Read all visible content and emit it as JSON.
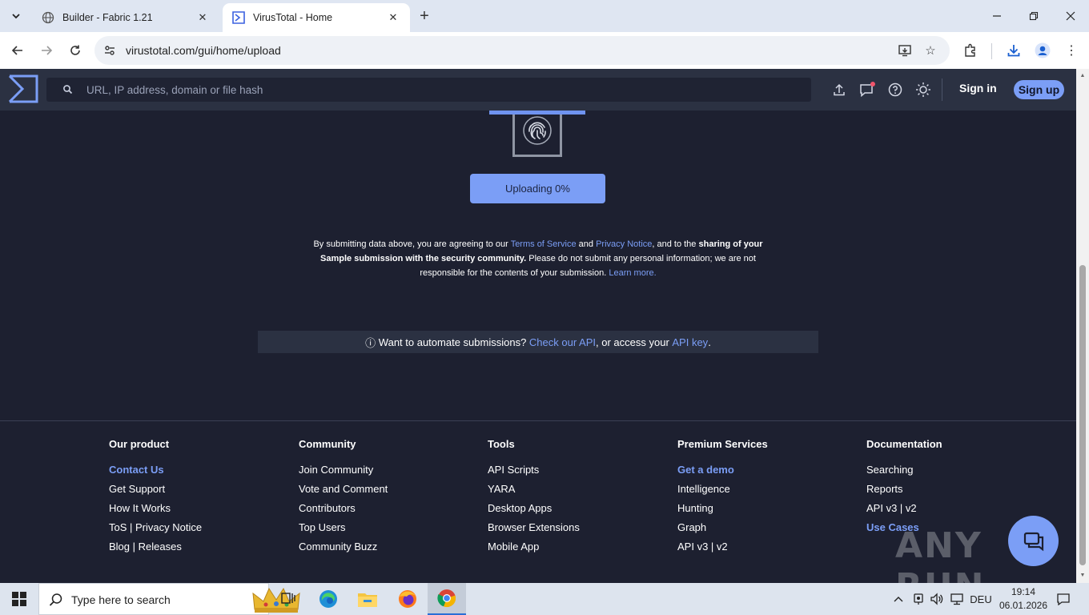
{
  "browser": {
    "tabs": [
      {
        "title": "Builder - Fabric 1.21",
        "active": false
      },
      {
        "title": "VirusTotal - Home",
        "active": true
      }
    ],
    "url": "virustotal.com/gui/home/upload"
  },
  "vt": {
    "search_placeholder": "URL, IP address, domain or file hash",
    "sign_in": "Sign in",
    "sign_up": "Sign up",
    "upload_button": "Uploading 0%",
    "upload_progress": 0,
    "terms": {
      "t1": "By submitting data above, you are agreeing to our ",
      "terms_link": "Terms of Service",
      "t2": " and ",
      "privacy_link": "Privacy Notice",
      "t3": ", and to the ",
      "bold": "sharing of your Sample submission with the security community.",
      "t4": " Please do not submit any personal information; we are not responsible for the contents of your submission. ",
      "learn_more": "Learn more."
    },
    "api_banner": {
      "icon": "ⓘ",
      "t1": " Want to automate submissions? ",
      "api_link": "Check our API",
      "t2": ", or access your ",
      "key_link": "API key",
      "t3": "."
    }
  },
  "footer": {
    "columns": [
      {
        "heading": "Our product",
        "items": [
          {
            "label": "Contact Us",
            "accent": true
          },
          {
            "label": "Get Support"
          },
          {
            "label": "How It Works"
          },
          {
            "label": "ToS | Privacy Notice"
          },
          {
            "label": "Blog | Releases"
          }
        ]
      },
      {
        "heading": "Community",
        "items": [
          {
            "label": "Join Community"
          },
          {
            "label": "Vote and Comment"
          },
          {
            "label": "Contributors"
          },
          {
            "label": "Top Users"
          },
          {
            "label": "Community Buzz"
          }
        ]
      },
      {
        "heading": "Tools",
        "items": [
          {
            "label": "API Scripts"
          },
          {
            "label": "YARA"
          },
          {
            "label": "Desktop Apps"
          },
          {
            "label": "Browser Extensions"
          },
          {
            "label": "Mobile App"
          }
        ]
      },
      {
        "heading": "Premium Services",
        "items": [
          {
            "label": "Get a demo",
            "accent": true
          },
          {
            "label": "Intelligence"
          },
          {
            "label": "Hunting"
          },
          {
            "label": "Graph"
          },
          {
            "label": "API v3 | v2"
          }
        ]
      },
      {
        "heading": "Documentation",
        "items": [
          {
            "label": "Searching"
          },
          {
            "label": "Reports"
          },
          {
            "label": "API v3 | v2"
          },
          {
            "label": "Use Cases",
            "accent": true
          }
        ]
      }
    ]
  },
  "watermark": "ANY RUN",
  "taskbar": {
    "search_text": "Type here to search",
    "language": "DEU",
    "time": "19:14",
    "date": "06.01.2026"
  },
  "colors": {
    "accent": "#7b9ef6",
    "page_bg": "#1d2030",
    "header_bg": "#2b3142"
  }
}
